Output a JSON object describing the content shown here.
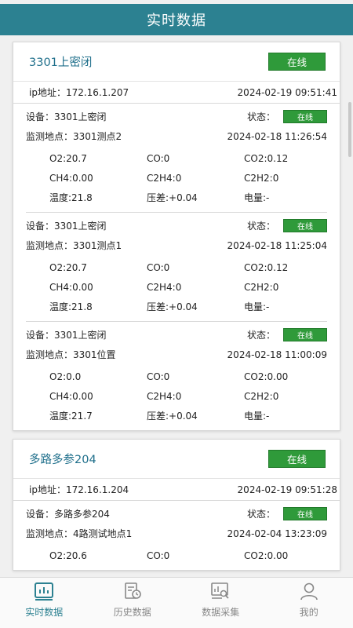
{
  "header": {
    "title": "实时数据"
  },
  "labels": {
    "ip_prefix": "ip地址：",
    "device_prefix": "设备：",
    "location_prefix": "监测地点：",
    "state_label": "状态："
  },
  "stations": [
    {
      "name": "3301上密闭",
      "status": "在线",
      "ip": "172.16.1.207",
      "time": "2024-02-19 09:51:41",
      "devices": [
        {
          "device": "3301上密闭",
          "status": "在线",
          "location": "3301测点2",
          "time": "2024-02-18 11:26:54",
          "readings": [
            "O2:20.7",
            "CO:0",
            "CO2:0.12",
            "CH4:0.00",
            "C2H4:0",
            "C2H2:0",
            "温度:21.8",
            "压差:+0.04",
            "电量:-"
          ]
        },
        {
          "device": "3301上密闭",
          "status": "在线",
          "location": "3301测点1",
          "time": "2024-02-18 11:25:04",
          "readings": [
            "O2:20.7",
            "CO:0",
            "CO2:0.12",
            "CH4:0.00",
            "C2H4:0",
            "C2H2:0",
            "温度:21.8",
            "压差:+0.04",
            "电量:-"
          ]
        },
        {
          "device": "3301上密闭",
          "status": "在线",
          "location": "3301位置",
          "time": "2024-02-18 11:00:09",
          "readings": [
            "O2:0.0",
            "CO:0",
            "CO2:0.00",
            "CH4:0.00",
            "C2H4:0",
            "C2H2:0",
            "温度:21.7",
            "压差:+0.04",
            "电量:-"
          ]
        }
      ]
    },
    {
      "name": "多路多参204",
      "status": "在线",
      "ip": "172.16.1.204",
      "time": "2024-02-19 09:51:28",
      "devices": [
        {
          "device": "多路多参204",
          "status": "在线",
          "location": "4路测试地点1",
          "time": "2024-02-04 13:23:09",
          "readings": [
            "O2:20.6",
            "CO:0",
            "CO2:0.00"
          ]
        }
      ]
    }
  ],
  "tabs": [
    {
      "label": "实时数据",
      "icon": "realtime-chart-icon",
      "active": true
    },
    {
      "label": "历史数据",
      "icon": "history-icon",
      "active": false
    },
    {
      "label": "数据采集",
      "icon": "data-collect-icon",
      "active": false
    },
    {
      "label": "我的",
      "icon": "user-icon",
      "active": false
    }
  ],
  "colors": {
    "primary": "#2c8191",
    "online": "#2f9a3a",
    "station_name": "#1f6f8b"
  }
}
